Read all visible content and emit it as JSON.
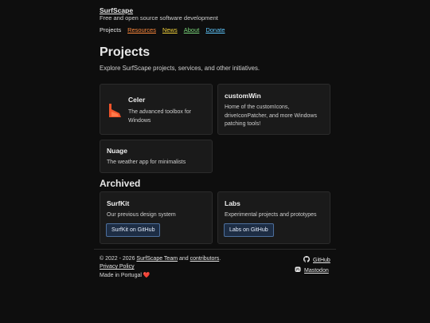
{
  "header": {
    "site_title": "SurfScape",
    "tagline": "Free and open source software development",
    "nav": {
      "projects": "Projects",
      "resources": "Resources",
      "news": "News",
      "about": "About",
      "donate": "Donate"
    }
  },
  "main": {
    "title": "Projects",
    "description": "Explore SurfScape projects, services, and other initiatives.",
    "projects": [
      {
        "name": "Celer",
        "description": "The advanced toolbox for Windows"
      },
      {
        "name": "customWin",
        "description": "Home of the customIcons, driveIconPatcher, and more Windows patching tools!"
      },
      {
        "name": "Nuage",
        "description": "The weather app for minimalists"
      }
    ],
    "archived_title": "Archived",
    "archived": [
      {
        "name": "SurfKit",
        "description": "Our previous design system",
        "button": "SurfKit on GitHub"
      },
      {
        "name": "Labs",
        "description": "Experimental projects and prototypes",
        "button": "Labs on GitHub"
      }
    ]
  },
  "footer": {
    "copyright_prefix": "© 2022 - 2026",
    "team_link": "SurfScape Team",
    "and": "and",
    "contributors_link": "contributors",
    "period": ".",
    "privacy": "Privacy Policy",
    "made_in": "Made in Portugal",
    "heart": "❤️",
    "github": "GitHub",
    "mastodon": "Mastodon"
  },
  "colors": {
    "resources": "#ff8a3d",
    "news": "#f2d13b",
    "about": "#7bd67b",
    "donate": "#5fc8ff",
    "celer_logo": "#f0542a"
  }
}
